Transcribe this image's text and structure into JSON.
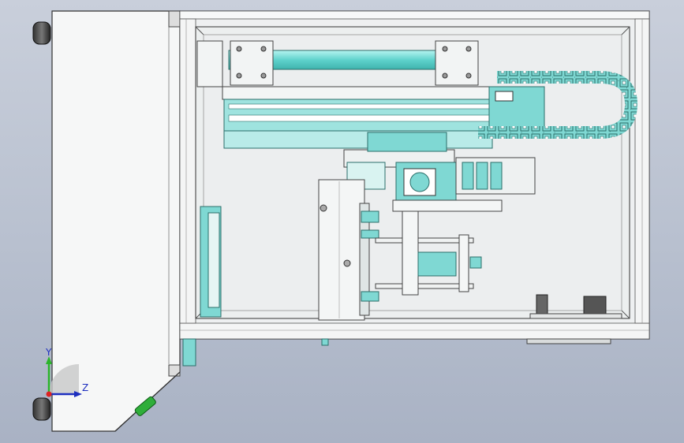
{
  "triad": {
    "y_label": "Y",
    "z_label": "Z"
  },
  "colors": {
    "background": "#bcc4d3",
    "part_cyan": "#7fd8d3",
    "frame_white": "#f4f6f6",
    "edge": "#3a3a3a",
    "handle_green": "#2fae3a"
  },
  "icons": {
    "triad": "coordinate-triad-icon"
  }
}
